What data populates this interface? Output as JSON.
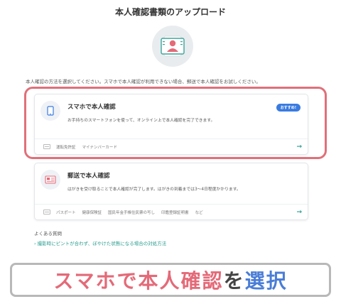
{
  "page": {
    "title": "本人確認書類のアップロード",
    "instruction": "本人確認の方法を選択してください。スマホで本人確認が利用できない場合、郵送で本人確認をお試しください。"
  },
  "options": [
    {
      "title": "スマホで本人確認",
      "badge": "おすすめ!",
      "description": "お手持ちのスマートフォンを使って、オンライン上で本人確認を完了できます。",
      "documents": [
        "運転免許証",
        "マイナンバーカード"
      ],
      "arrow": "→",
      "icon": "smartphone-icon"
    },
    {
      "title": "郵送で本人確認",
      "description": "はがきを受け取ることで本人確認が完了します。はがきの到着までは3〜4日程度かかります。",
      "documents": [
        "パスポート",
        "健康保険証",
        "国民年金手帳住民票の写し",
        "印鑑登録証明書",
        "など"
      ],
      "arrow": "→",
      "icon": "postcard-icon"
    }
  ],
  "faq": {
    "label": "よくある質問",
    "link": "撮影時にピントが合わず、ぼやけた状態になる場合の対処方法"
  },
  "caption": {
    "part1": "スマホで本人確認",
    "part2": "を",
    "part3": "選択"
  },
  "colors": {
    "highlight": "#e0707a",
    "badge": "#3a7be0",
    "link": "#2a9d8f",
    "caption_red": "#e46a78",
    "caption_blue": "#4a7dd6"
  }
}
